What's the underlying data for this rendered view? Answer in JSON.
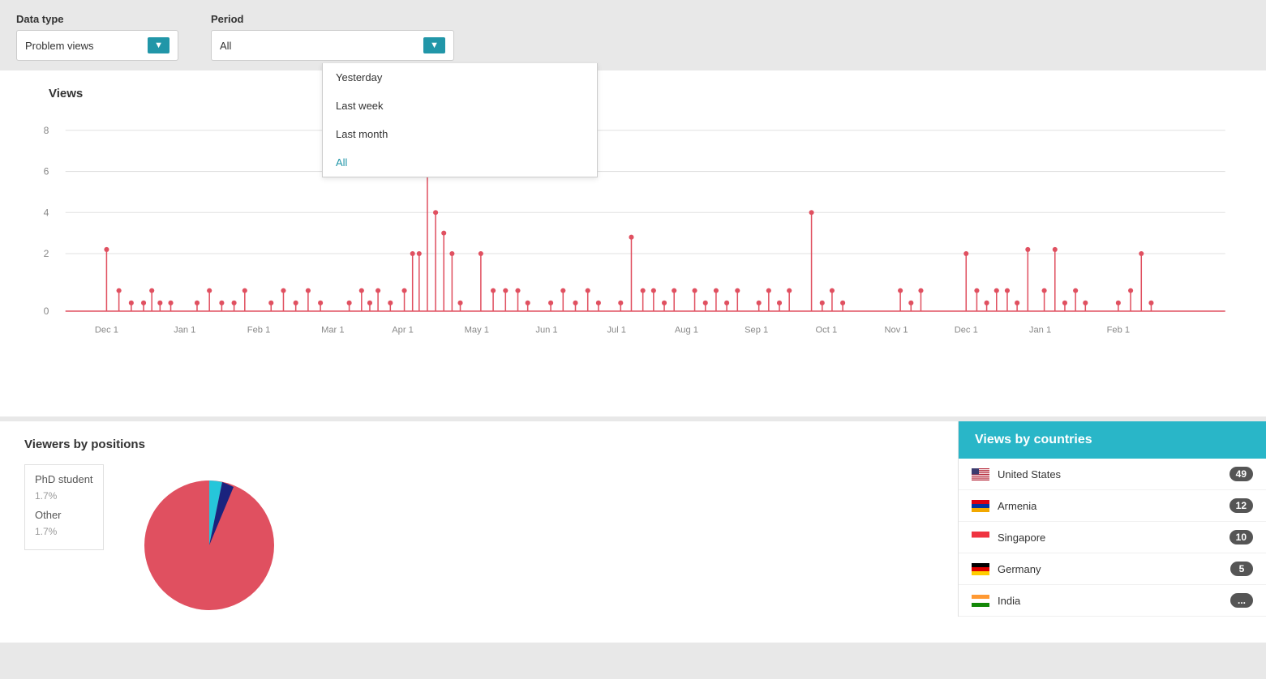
{
  "controls": {
    "datatype_label": "Data type",
    "datatype_value": "Problem views",
    "period_label": "Period",
    "period_value": "All",
    "dropdown_options": [
      {
        "label": "Yesterday",
        "active": false
      },
      {
        "label": "Last week",
        "active": false
      },
      {
        "label": "Last month",
        "active": false
      },
      {
        "label": "All",
        "active": true
      }
    ]
  },
  "chart": {
    "title": "Views",
    "y_labels": [
      "8",
      "6",
      "4",
      "2",
      "0"
    ],
    "x_labels": [
      "Dec 1",
      "Jan 1",
      "Feb 1",
      "Mar 1",
      "Apr 1",
      "May 1",
      "Jun 1",
      "Jul 1",
      "Aug 1",
      "Sep 1",
      "Oct 1",
      "Nov 1",
      "Dec 1",
      "Jan 1",
      "Feb 1"
    ]
  },
  "viewers_by_positions": {
    "title": "Viewers by positions",
    "legend": [
      {
        "label": "PhD student",
        "pct": "1.7%"
      },
      {
        "label": "Other",
        "pct": "1.7%"
      }
    ]
  },
  "countries": {
    "title": "Views by countries",
    "items": [
      {
        "name": "United States",
        "count": "49",
        "flag": "us"
      },
      {
        "name": "Armenia",
        "count": "12",
        "flag": "am"
      },
      {
        "name": "Singapore",
        "count": "10",
        "flag": "sg"
      },
      {
        "name": "Germany",
        "count": "5",
        "flag": "de"
      },
      {
        "name": "India",
        "count": "...",
        "flag": "in"
      }
    ]
  }
}
